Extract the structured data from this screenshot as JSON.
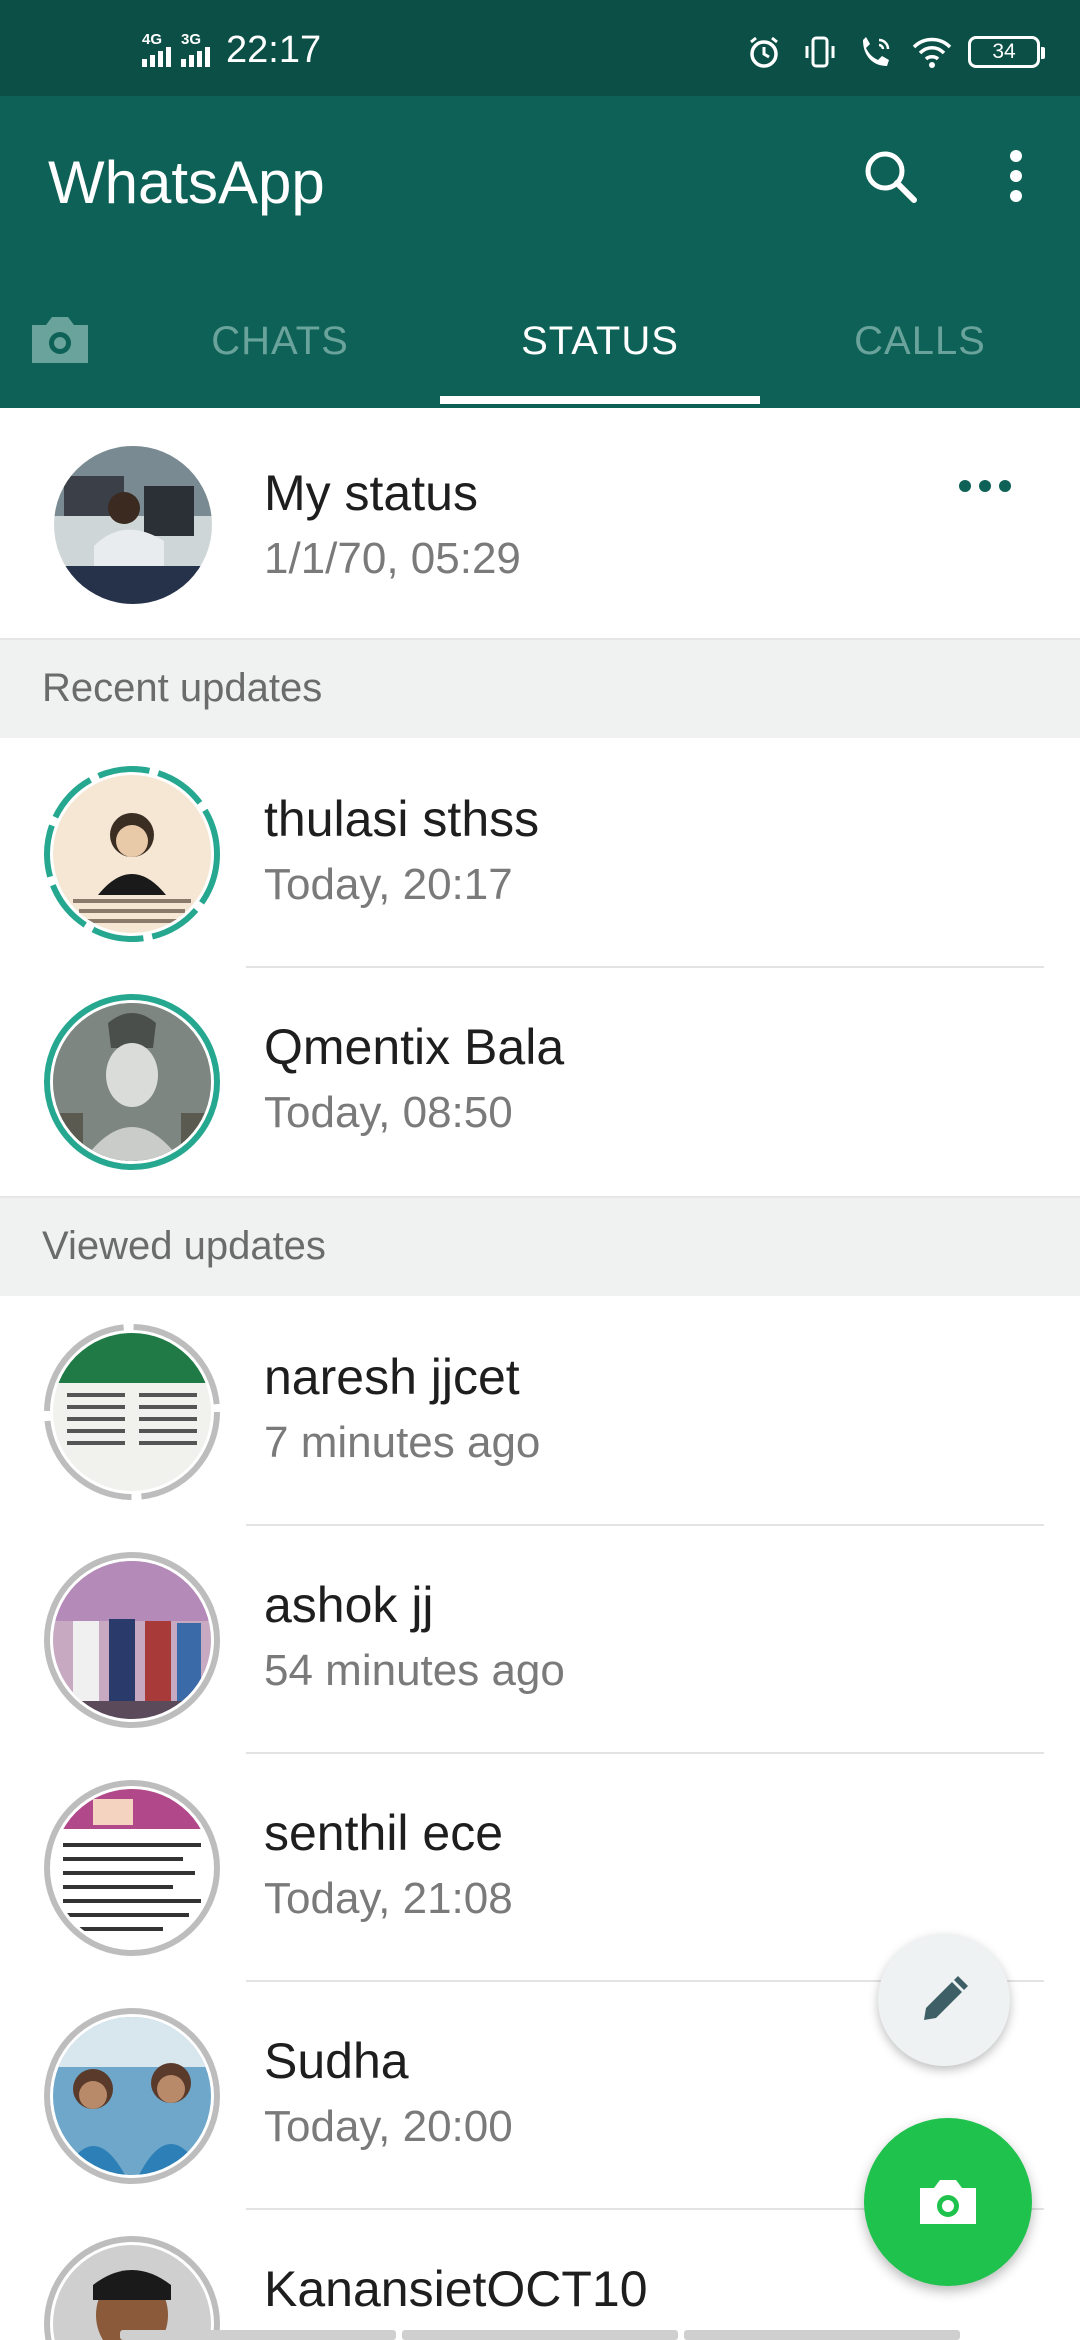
{
  "status_bar": {
    "net1": "4G",
    "net2": "3G",
    "time": "22:17",
    "battery": "34"
  },
  "app_bar": {
    "title": "WhatsApp"
  },
  "tabs": {
    "chats": "CHATS",
    "status": "STATUS",
    "calls": "CALLS",
    "active": "STATUS"
  },
  "my_status": {
    "name": "My status",
    "time": "1/1/70, 05:29"
  },
  "recent": {
    "header": "Recent updates",
    "items": [
      {
        "name": "thulasi sthss",
        "time": "Today, 20:17"
      },
      {
        "name": "Qmentix Bala",
        "time": "Today, 08:50"
      }
    ]
  },
  "viewed": {
    "header": "Viewed updates",
    "items": [
      {
        "name": "naresh jjcet",
        "time": "7 minutes ago"
      },
      {
        "name": "ashok jj",
        "time": "54 minutes ago"
      },
      {
        "name": "senthil ece",
        "time": "Today, 21:08"
      },
      {
        "name": "Sudha",
        "time": "Today, 20:00"
      },
      {
        "name": "KanansietOCT10",
        "time": ""
      }
    ]
  },
  "colors": {
    "status_bar": "#0b4f46",
    "app_bar": "#0e6156",
    "accent": "#25a790",
    "fab": "#1ec24c",
    "viewed_ring": "#bdbdbd"
  }
}
